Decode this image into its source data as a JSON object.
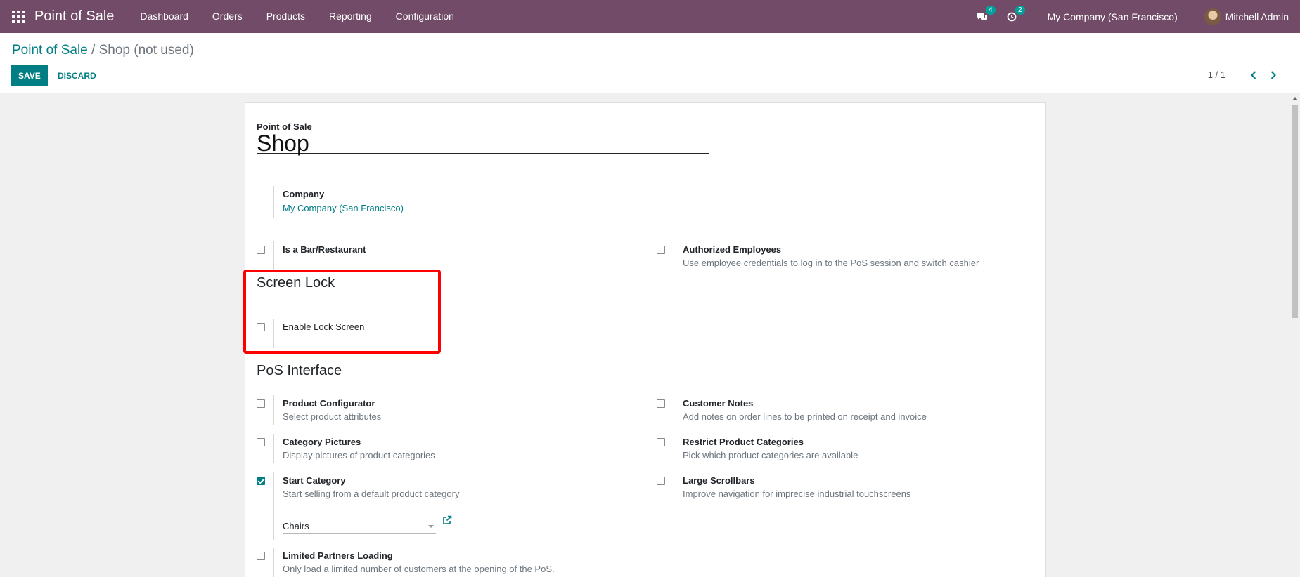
{
  "navbar": {
    "app_name": "Point of Sale",
    "menu": [
      "Dashboard",
      "Orders",
      "Products",
      "Reporting",
      "Configuration"
    ],
    "messages_count": "4",
    "activities_count": "2",
    "company": "My Company (San Francisco)",
    "user": "Mitchell Admin"
  },
  "control_panel": {
    "breadcrumb_parent": "Point of Sale",
    "breadcrumb_sep": "/",
    "breadcrumb_current": "Shop (not used)",
    "save_label": "SAVE",
    "discard_label": "DISCARD",
    "pager": "1 / 1"
  },
  "form": {
    "name_label": "Point of Sale",
    "name_value": "Shop",
    "company_label": "Company",
    "company_value": "My Company (San Francisco)",
    "settings_top": [
      {
        "title": "Is a Bar/Restaurant",
        "desc": "",
        "checked": false
      },
      {
        "title": "Authorized Employees",
        "desc": "Use employee credentials to log in to the PoS session and switch cashier",
        "checked": false
      }
    ],
    "screen_lock": {
      "title": "Screen Lock",
      "setting": {
        "title": "Enable Lock Screen",
        "checked": false
      }
    },
    "pos_interface": {
      "title": "PoS Interface",
      "left": [
        {
          "title": "Product Configurator",
          "desc": "Select product attributes",
          "checked": false
        },
        {
          "title": "Category Pictures",
          "desc": "Display pictures of product categories",
          "checked": false
        },
        {
          "title": "Start Category",
          "desc": "Start selling from a default product category",
          "checked": true
        },
        {
          "title": "Limited Partners Loading",
          "desc": "Only load a limited number of customers at the opening of the PoS.",
          "checked": false
        }
      ],
      "right": [
        {
          "title": "Customer Notes",
          "desc": "Add notes on order lines to be printed on receipt and invoice",
          "checked": false
        },
        {
          "title": "Restrict Product Categories",
          "desc": "Pick which product categories are available",
          "checked": false
        },
        {
          "title": "Large Scrollbars",
          "desc": "Improve navigation for imprecise industrial touchscreens",
          "checked": false
        }
      ],
      "start_category_value": "Chairs"
    }
  },
  "colors": {
    "navbar": "#714b67",
    "primary": "#017e84",
    "highlight": "#ff0000"
  }
}
